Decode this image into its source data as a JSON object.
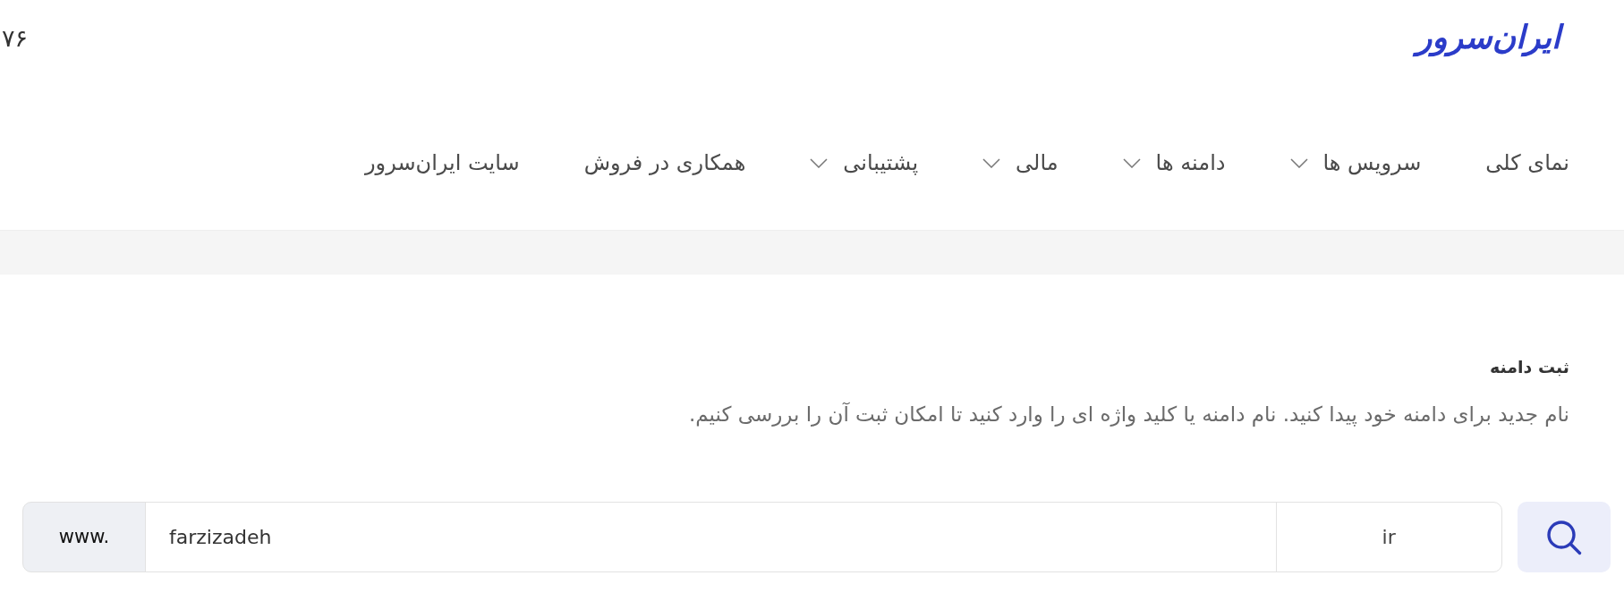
{
  "top_bar": {
    "number_text": "۷۶",
    "logo": "ایران‌سرور"
  },
  "nav": {
    "items": [
      {
        "label": "نمای کلی",
        "kind": "link"
      },
      {
        "label": "سرویس ها",
        "kind": "dropdown"
      },
      {
        "label": "دامنه ها",
        "kind": "dropdown"
      },
      {
        "label": "مالی",
        "kind": "dropdown"
      },
      {
        "label": "پشتیبانی",
        "kind": "dropdown"
      },
      {
        "label": "همکاری در فروش",
        "kind": "link"
      },
      {
        "label": "سایت ایران‌سرور",
        "kind": "link"
      }
    ]
  },
  "domain_register": {
    "title": "ثبت دامنه",
    "description": "نام جدید برای دامنه خود پیدا کنید. نام دامنه یا کلید واژه ای را وارد کنید تا امکان ثبت آن را بررسی کنیم."
  },
  "search": {
    "prefix": "www.",
    "value": "farzizadeh",
    "tld": "ir"
  }
}
